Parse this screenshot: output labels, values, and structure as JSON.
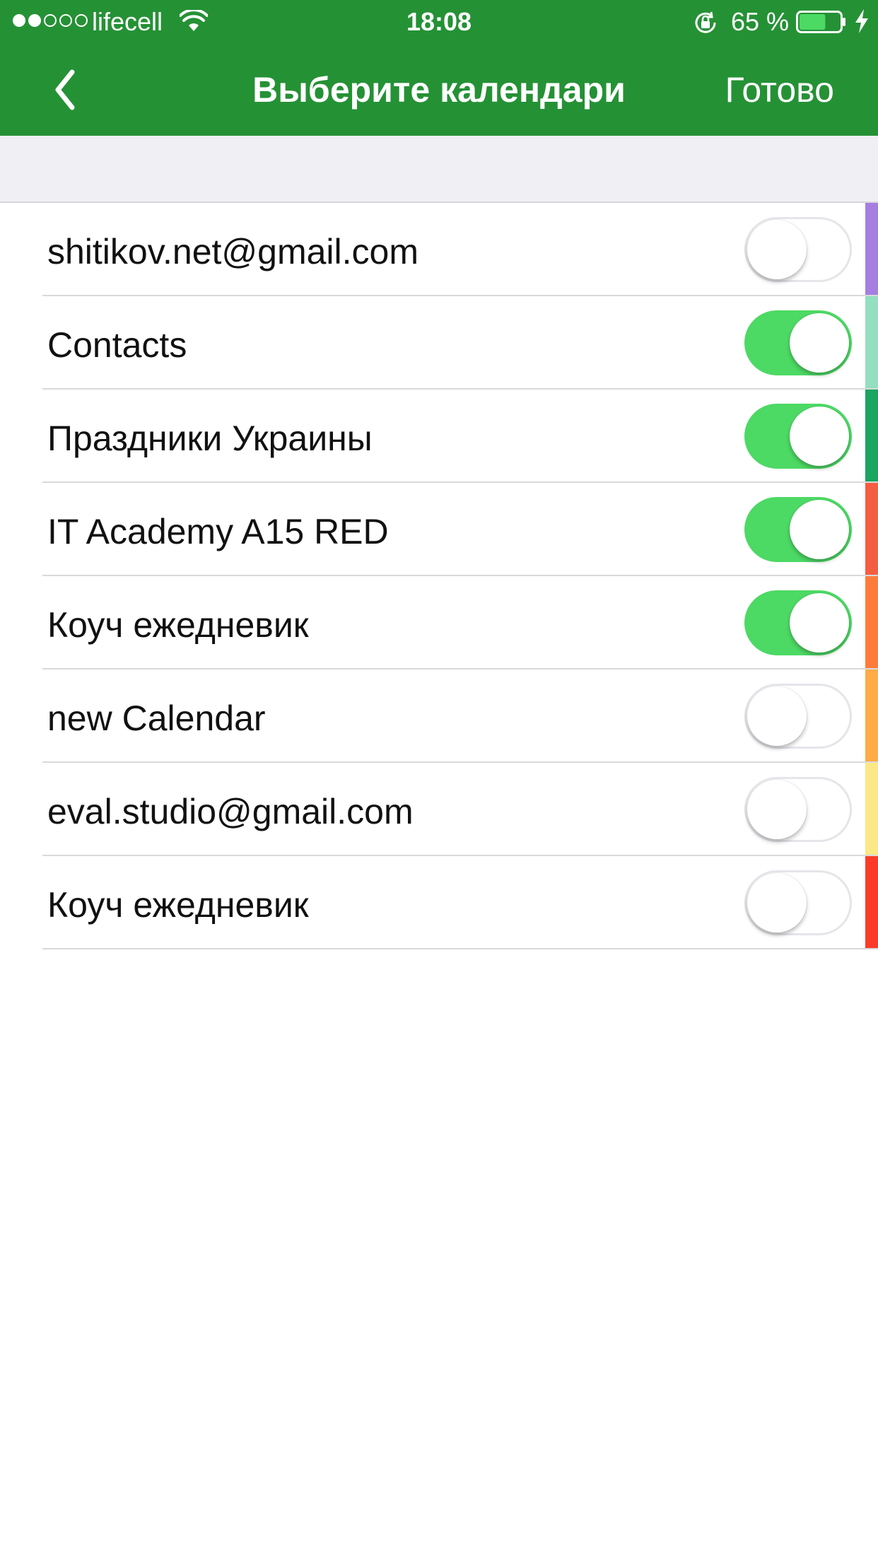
{
  "status_bar": {
    "signal_bars": [
      true,
      true,
      false,
      false,
      false
    ],
    "carrier": "lifecell",
    "time": "18:08",
    "battery_percent": "65 %",
    "battery_level": 0.65
  },
  "nav": {
    "back_icon": "chevron-left-icon",
    "title": "Выберите календари",
    "done_label": "Готово"
  },
  "colors": {
    "nav_background": "#259135",
    "toggle_on": "#4cd964",
    "section_background": "#efeff4"
  },
  "calendars": [
    {
      "name": "shitikov.net@gmail.com",
      "enabled": false,
      "color": "#a57ee0"
    },
    {
      "name": "Contacts",
      "enabled": true,
      "color": "#93dfc0"
    },
    {
      "name": "Праздники Украины",
      "enabled": true,
      "color": "#1aa560"
    },
    {
      "name": "IT Academy A15 RED",
      "enabled": true,
      "color": "#f55d41"
    },
    {
      "name": "Коуч ежедневик",
      "enabled": true,
      "color": "#ff7b3c"
    },
    {
      "name": "new Calendar",
      "enabled": false,
      "color": "#ffab48"
    },
    {
      "name": "eval.studio@gmail.com",
      "enabled": false,
      "color": "#fbe886"
    },
    {
      "name": "Коуч ежедневик",
      "enabled": false,
      "color": "#fb3b28"
    }
  ]
}
